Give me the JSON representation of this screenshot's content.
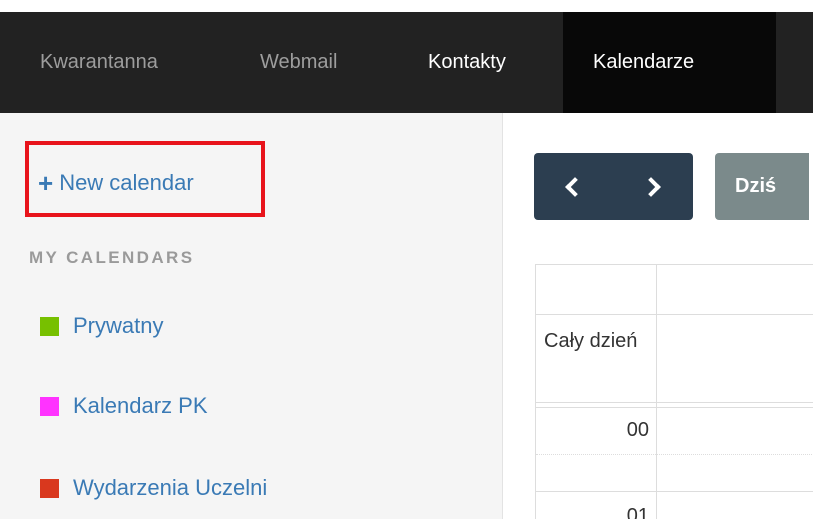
{
  "nav": {
    "tabs": [
      {
        "label": "Kwarantanna"
      },
      {
        "label": "Webmail"
      },
      {
        "label": "Kontakty"
      },
      {
        "label": "Kalendarze"
      }
    ]
  },
  "sidebar": {
    "new_calendar_label": "New calendar",
    "section_title": "MY CALENDARS",
    "calendars": [
      {
        "label": "Prywatny",
        "color": "#77c000"
      },
      {
        "label": "Kalendarz PK",
        "color": "#ff33ff"
      },
      {
        "label": "Wydarzenia Uczelni",
        "color": "#d9381e"
      }
    ]
  },
  "toolbar": {
    "today_label": "Dziś"
  },
  "calendar_grid": {
    "all_day_label": "Cały dzień",
    "hours": [
      "00",
      "01"
    ]
  },
  "colors": {
    "navbar_bg": "#222222",
    "active_tab_bg": "#080808",
    "link": "#3a7ab5",
    "highlight": "#e8141b",
    "nav_button": "#2c3e50",
    "today_button": "#7b8a8b"
  }
}
